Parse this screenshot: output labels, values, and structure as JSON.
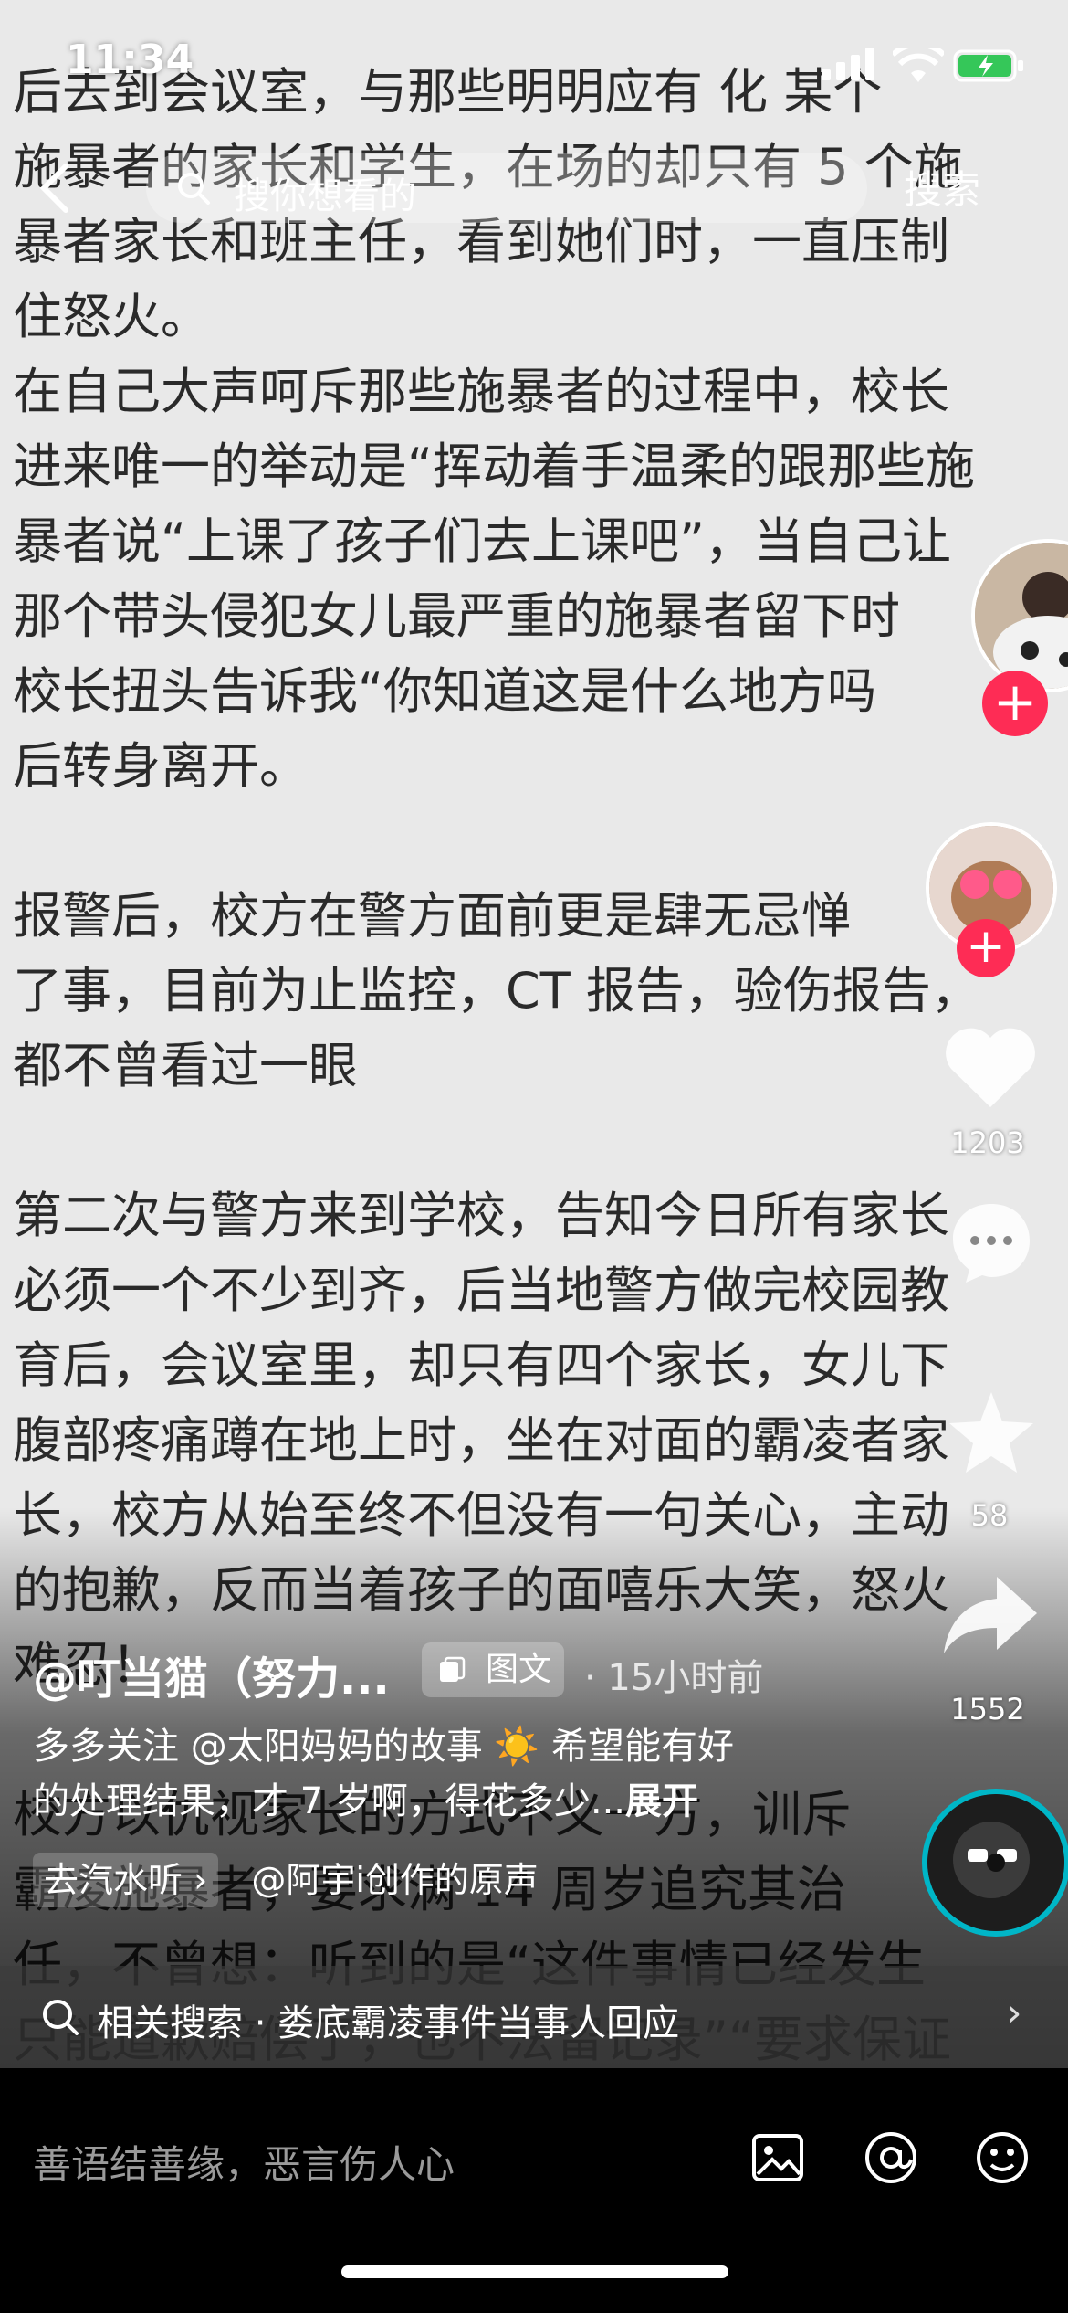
{
  "status_bar": {
    "time": "11:34"
  },
  "search": {
    "placeholder": "搜你想看的",
    "button": "搜索"
  },
  "post_text": [
    "后去到会议室，与那些明明应有 化 某个",
    "施暴者的家长和学生，在场的却只有 5 个施",
    "暴者家长和班主任，看到她们时，一直压制",
    "住怒火。",
    "在自己大声呵斥那些施暴者的过程中，校长",
    "进来唯一的举动是“挥动着手温柔的跟那些施",
    "暴者说“上课了孩子们去上课吧”，当自己让",
    "那个带头侵犯女儿最严重的施暴者留下时",
    "校长扭头告诉我“你知道这是什么地方吗",
    "后转身离开。",
    "",
    "报警后，校方在警方面前更是肆无忌惮",
    "了事，目前为止监控，CT 报告，验伤报告，",
    "都不曾看过一眼",
    "",
    "第二次与警方来到学校，告知今日所有家长",
    "必须一个不少到齐，后当地警方做完校园教",
    "育后，会议室里，却只有四个家长，女儿下",
    "腹部疼痛蹲在地上时，坐在对面的霸凌者家",
    "长，校方从始至终不但没有一句关心，主动",
    "的抱歉，反而当着孩子的面嘻乐大笑，怒火",
    "难忍！",
    "",
    "校方以仇视家长的方式不义一方，训斥",
    "霸凌施暴者，要求满 14 周岁追究其治",
    "任，不曾想：听到的是“这件事情已经发生",
    "只能道歉赔偿了，也不法留记录”“要求保证"
  ],
  "rail": {
    "likes": "1203",
    "favorites": "58",
    "shares": "1552"
  },
  "post": {
    "author": "@叮当猫（努力...",
    "type_label": "图文",
    "time_ago": "· 15小时前",
    "desc_line1": "多多关注 @太阳妈妈的故事 ☀️ 希望能有好",
    "desc_line2": "的处理结果，才 7 岁啊，得花多少...",
    "expand": "展开",
    "music_link": "去汽水听 ›",
    "music_sound": "@阿宇i创作的原声"
  },
  "related": {
    "text": "相关搜索 · 娄底霸凌事件当事人回应"
  },
  "comment": {
    "placeholder": "善语结善缘，恶言伤人心"
  },
  "colors": {
    "accent": "#fe2c55",
    "teal": "#00b6c7"
  }
}
